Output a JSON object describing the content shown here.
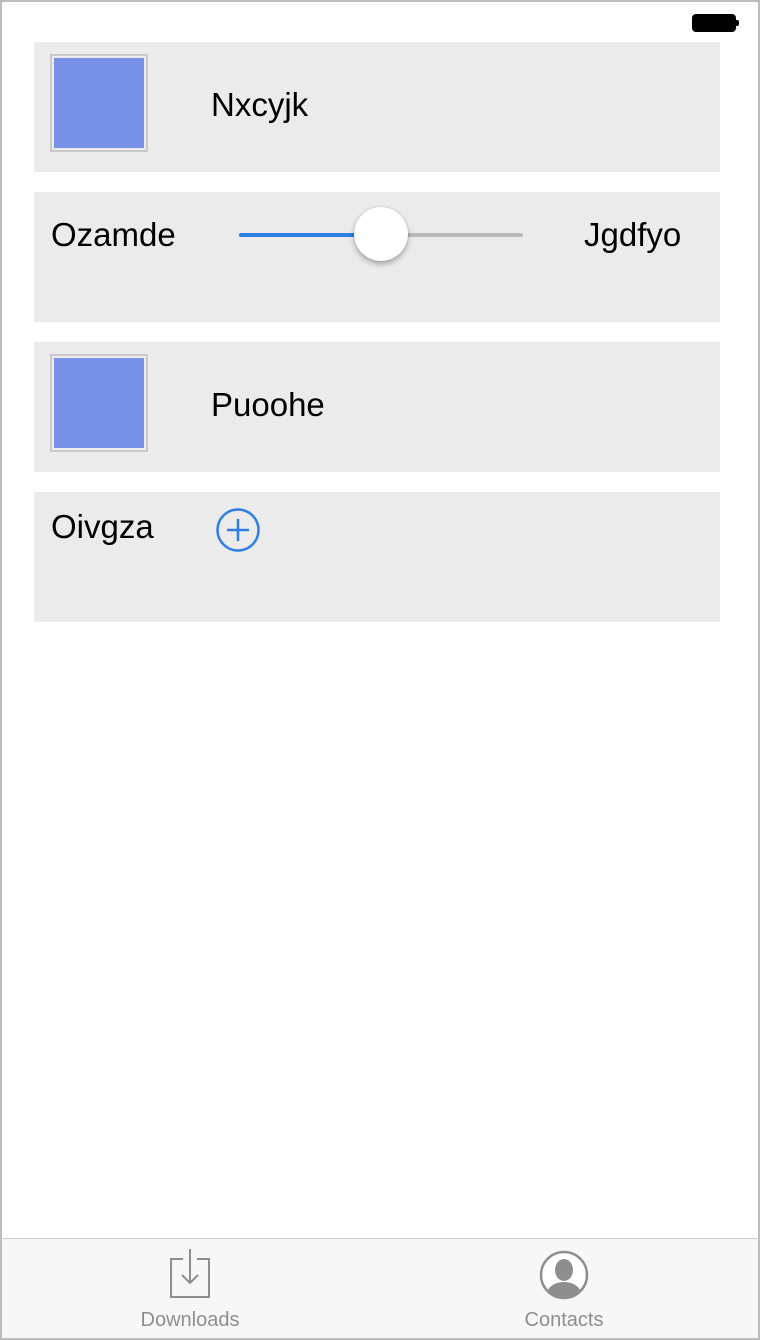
{
  "status_bar": {
    "battery_icon": "battery-full-icon"
  },
  "rows": [
    {
      "label": "Nxcyjk",
      "thumbnail_color": "#7890e6"
    },
    {
      "left_label": "Ozamde",
      "right_label": "Jgdfyo",
      "slider_value": 0.5
    },
    {
      "label": "Puoohe",
      "thumbnail_color": "#7890e6"
    },
    {
      "label": "Oivgza",
      "add_icon": "plus-circle-icon"
    }
  ],
  "tabs": [
    {
      "label": "Downloads",
      "icon": "download-tray-icon"
    },
    {
      "label": "Contacts",
      "icon": "person-circle-icon"
    }
  ],
  "colors": {
    "accent": "#2d7fe6",
    "row_background": "#ebebeb",
    "tab_label": "#8e8e8e"
  }
}
